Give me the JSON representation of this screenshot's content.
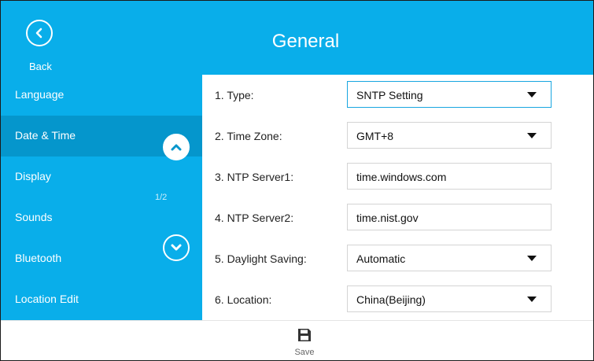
{
  "header": {
    "back_label": "Back",
    "title": "General",
    "back_icon": "chevron-left-icon"
  },
  "sidebar": {
    "items": [
      {
        "label": "Language"
      },
      {
        "label": "Date & Time"
      },
      {
        "label": "Display"
      },
      {
        "label": "Sounds"
      },
      {
        "label": "Bluetooth"
      },
      {
        "label": "Location Edit"
      }
    ],
    "active_item": "Date & Time",
    "page_indicator": "1/2",
    "scroll_up_icon": "chevron-up-icon",
    "scroll_down_icon": "chevron-down-icon"
  },
  "form": {
    "rows": [
      {
        "label": "1. Type:",
        "value": "SNTP Setting",
        "control": "dropdown"
      },
      {
        "label": "2. Time Zone:",
        "value": "GMT+8",
        "control": "dropdown"
      },
      {
        "label": "3. NTP Server1:",
        "value": "time.windows.com",
        "control": "text"
      },
      {
        "label": "4. NTP Server2:",
        "value": "time.nist.gov",
        "control": "text"
      },
      {
        "label": "5. Daylight Saving:",
        "value": "Automatic",
        "control": "dropdown"
      },
      {
        "label": "6. Location:",
        "value": "China(Beijing)",
        "control": "dropdown"
      }
    ]
  },
  "footer": {
    "save_label": "Save",
    "save_icon": "floppy-disk-icon"
  },
  "colors": {
    "accent": "#09aeea",
    "active_item": "#0596cc",
    "focus_border": "#18a6e0"
  }
}
